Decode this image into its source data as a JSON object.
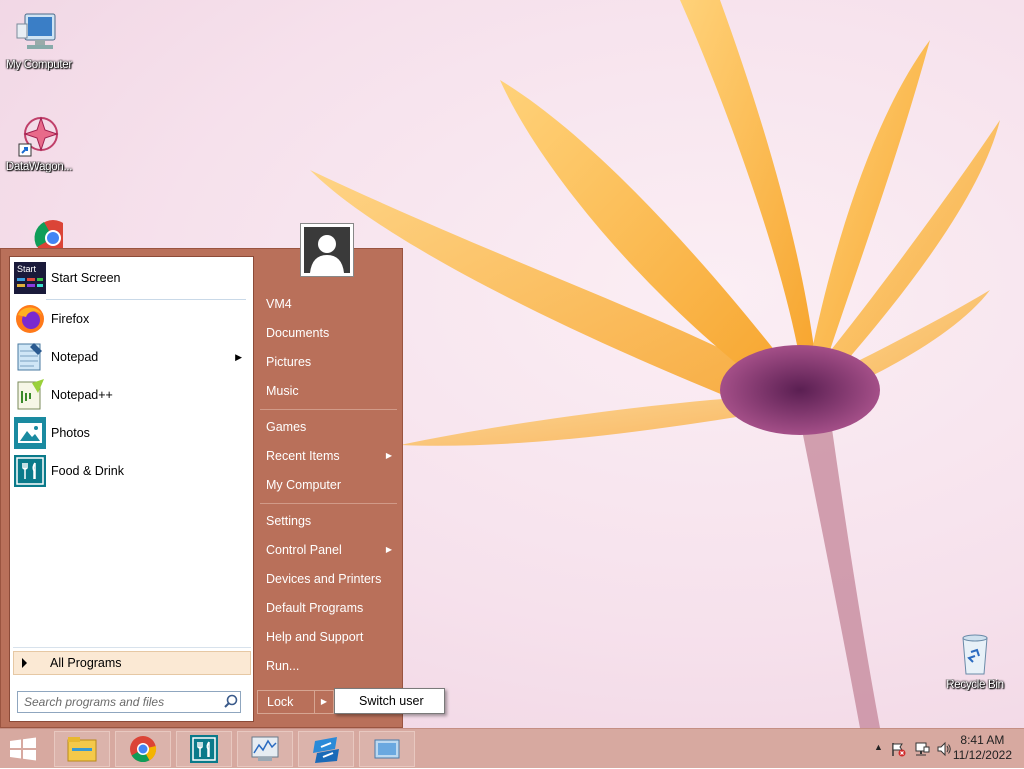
{
  "desktop": {
    "icons": [
      {
        "label": "My Computer"
      },
      {
        "label": "DataWagon..."
      },
      {
        "label": "Recycle Bin"
      }
    ]
  },
  "start_menu": {
    "pinned": [
      {
        "label": "Start Screen",
        "icon": "start-screen-icon",
        "icon_text": "Start"
      },
      {
        "label": "Firefox",
        "icon": "firefox-icon"
      },
      {
        "label": "Notepad",
        "icon": "notepad-icon",
        "has_submenu": true
      },
      {
        "label": "Notepad++",
        "icon": "notepad-plus-plus-icon"
      },
      {
        "label": "Photos",
        "icon": "photos-icon"
      },
      {
        "label": "Food & Drink",
        "icon": "food-drink-icon"
      }
    ],
    "all_programs_label": "All Programs",
    "search_placeholder": "Search programs and files",
    "right_items": [
      {
        "label": "VM4"
      },
      {
        "label": "Documents"
      },
      {
        "label": "Pictures"
      },
      {
        "label": "Music"
      },
      {
        "label": "Games"
      },
      {
        "label": "Recent Items",
        "has_submenu": true
      },
      {
        "label": "My Computer"
      },
      {
        "label": "Settings"
      },
      {
        "label": "Control Panel",
        "has_submenu": true
      },
      {
        "label": "Devices and Printers"
      },
      {
        "label": "Default Programs"
      },
      {
        "label": "Help and Support"
      },
      {
        "label": "Run..."
      }
    ],
    "lock_label": "Lock",
    "switch_user_label": "Switch user"
  },
  "taskbar": {
    "apps": [
      {
        "name": "file-explorer-icon"
      },
      {
        "name": "chrome-icon"
      },
      {
        "name": "food-drink-icon"
      },
      {
        "name": "performance-monitor-icon"
      },
      {
        "name": "remote-desktop-icon"
      },
      {
        "name": "window-app-icon"
      }
    ],
    "time": "8:41 AM",
    "date": "11/12/2022"
  },
  "colors": {
    "start_menu_bg": "#b9705a",
    "taskbar_bg": "#d7a9a0",
    "all_programs_highlight": "#fbe9d4"
  }
}
